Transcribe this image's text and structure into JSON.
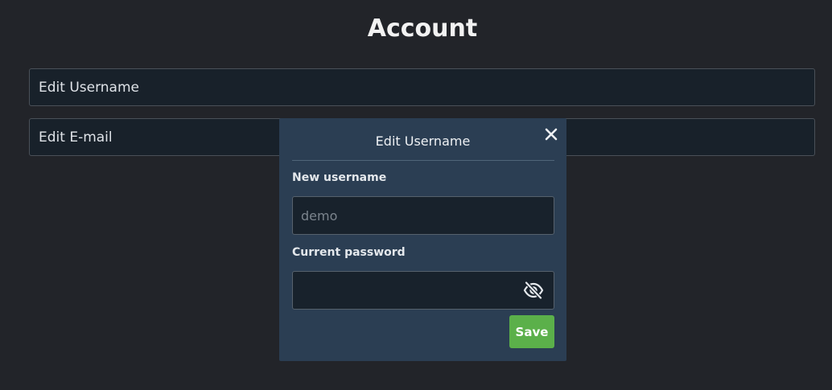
{
  "page": {
    "title": "Account"
  },
  "account_options": [
    {
      "label": "Edit Username"
    },
    {
      "label": "Edit E-mail"
    }
  ],
  "modal": {
    "title": "Edit Username",
    "close_icon": "close-icon",
    "username_label": "New username",
    "username_placeholder": "demo",
    "username_value": "",
    "password_label": "Current password",
    "password_value": "",
    "visibility_icon": "eye-slash-icon",
    "save_label": "Save"
  },
  "colors": {
    "background": "#222429",
    "row_background": "#18212a",
    "modal_background": "#2b3e53",
    "save_button": "#5bb04a"
  }
}
